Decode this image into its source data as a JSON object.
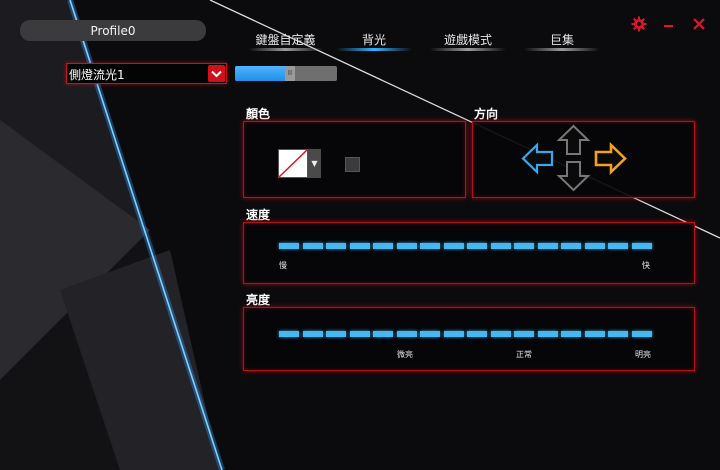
{
  "profile": {
    "name": "Profile0"
  },
  "tabs": [
    {
      "label": "鍵盤自定義",
      "active": false
    },
    {
      "label": "背光",
      "active": true
    },
    {
      "label": "遊戲模式",
      "active": false
    },
    {
      "label": "巨集",
      "active": false
    }
  ],
  "window_controls": {
    "settings_icon": "gear-icon",
    "minimize_icon": "minimize-icon",
    "close_icon": "close-icon",
    "accent": "#e2142b"
  },
  "lighting_mode": {
    "value": "側燈流光1"
  },
  "toggle": {
    "state": "on",
    "knob_text": "II"
  },
  "color_section": {
    "title": "顏色",
    "swatch_color": "#ffffff",
    "checked": false
  },
  "direction_section": {
    "title": "方向",
    "left_color": "#3aa8e8",
    "right_color": "#f2a21b",
    "inactive_color": "#777777",
    "selected": "right"
  },
  "speed_section": {
    "title": "速度",
    "segments": 16,
    "level": 16,
    "min_label": "慢",
    "max_label": "快"
  },
  "brightness_section": {
    "title": "亮度",
    "segments": 16,
    "level": 16,
    "labels": [
      "微亮",
      "正常",
      "明亮"
    ]
  },
  "colors": {
    "accent_red": "#c6141f",
    "segment_blue": "#49b7ef"
  }
}
